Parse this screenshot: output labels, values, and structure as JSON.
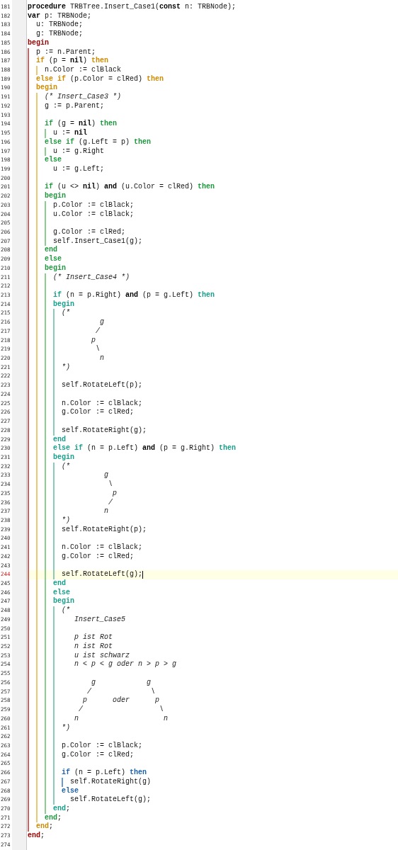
{
  "lines": [
    {
      "number": "181",
      "current": false,
      "tokens": [
        {
          "text": "procedure",
          "kind": "keyword",
          "color": "#000000"
        },
        {
          "text": " TRBTree.Insert_Case1(",
          "kind": "plain"
        },
        {
          "text": "const",
          "kind": "keyword",
          "color": "#000000"
        },
        {
          "text": " n: TRBNode);",
          "kind": "plain"
        }
      ]
    },
    {
      "number": "182",
      "current": false,
      "tokens": [
        {
          "text": "var",
          "kind": "keyword",
          "color": "#000000"
        },
        {
          "text": " p: TRBNode;",
          "kind": "plain"
        }
      ]
    },
    {
      "number": "183",
      "current": false,
      "tokens": [
        {
          "text": "  u: TRBNode;",
          "kind": "plain"
        }
      ]
    },
    {
      "number": "184",
      "current": false,
      "tokens": [
        {
          "text": "  g: TRBNode;",
          "kind": "plain"
        }
      ]
    },
    {
      "number": "185",
      "current": false,
      "tokens": [
        {
          "text": "begin",
          "kind": "keyword",
          "color": "#a00000"
        }
      ]
    },
    {
      "number": "186",
      "current": false,
      "guides": [
        {
          "color": "#d06060"
        }
      ],
      "tokens": [
        {
          "text": "  p := n.Parent;",
          "kind": "plain"
        }
      ]
    },
    {
      "number": "187",
      "current": false,
      "guides": [
        {
          "color": "#d06060"
        }
      ],
      "tokens": [
        {
          "text": "  if",
          "kind": "keyword",
          "color": "#d08a00"
        },
        {
          "text": " (p = ",
          "kind": "plain"
        },
        {
          "text": "nil",
          "kind": "keyword",
          "color": "#000000"
        },
        {
          "text": ") ",
          "kind": "plain"
        },
        {
          "text": "then",
          "kind": "keyword",
          "color": "#d08a00"
        }
      ]
    },
    {
      "number": "188",
      "current": false,
      "guides": [
        {
          "color": "#d06060"
        },
        {
          "color": "#e8c870"
        }
      ],
      "tokens": [
        {
          "text": "    n.Color := clBlack",
          "kind": "plain"
        }
      ]
    },
    {
      "number": "189",
      "current": false,
      "guides": [
        {
          "color": "#d06060"
        }
      ],
      "tokens": [
        {
          "text": "  else if",
          "kind": "keyword",
          "color": "#d08a00"
        },
        {
          "text": " (p.Color = clRed) ",
          "kind": "plain"
        },
        {
          "text": "then",
          "kind": "keyword",
          "color": "#d08a00"
        }
      ]
    },
    {
      "number": "190",
      "current": false,
      "guides": [
        {
          "color": "#d06060"
        }
      ],
      "tokens": [
        {
          "text": "  begin",
          "kind": "keyword",
          "color": "#d08a00"
        }
      ]
    },
    {
      "number": "191",
      "current": false,
      "guides": [
        {
          "color": "#d06060"
        },
        {
          "color": "#e8c870"
        }
      ],
      "tokens": [
        {
          "text": "    (* Insert_Case3 *)",
          "kind": "comment"
        }
      ]
    },
    {
      "number": "192",
      "current": false,
      "guides": [
        {
          "color": "#d06060"
        },
        {
          "color": "#e8c870"
        }
      ],
      "tokens": [
        {
          "text": "    g := p.Parent;",
          "kind": "plain"
        }
      ]
    },
    {
      "number": "193",
      "current": false,
      "guides": [
        {
          "color": "#d06060"
        },
        {
          "color": "#e8c870"
        }
      ]
    },
    {
      "number": "194",
      "current": false,
      "guides": [
        {
          "color": "#d06060"
        },
        {
          "color": "#e8c870"
        }
      ],
      "tokens": [
        {
          "text": "    if",
          "kind": "keyword",
          "color": "#1a9a3a"
        },
        {
          "text": " (g = ",
          "kind": "plain"
        },
        {
          "text": "nil",
          "kind": "keyword",
          "color": "#000000"
        },
        {
          "text": ") ",
          "kind": "plain"
        },
        {
          "text": "then",
          "kind": "keyword",
          "color": "#1a9a3a"
        }
      ]
    },
    {
      "number": "195",
      "current": false,
      "guides": [
        {
          "color": "#d06060"
        },
        {
          "color": "#e8c870"
        },
        {
          "color": "#8ccc8c"
        }
      ],
      "tokens": [
        {
          "text": "      u := ",
          "kind": "plain"
        },
        {
          "text": "nil",
          "kind": "keyword",
          "color": "#000000"
        }
      ]
    },
    {
      "number": "196",
      "current": false,
      "guides": [
        {
          "color": "#d06060"
        },
        {
          "color": "#e8c870"
        }
      ],
      "tokens": [
        {
          "text": "    else if",
          "kind": "keyword",
          "color": "#1a9a3a"
        },
        {
          "text": " (g.Left = p) ",
          "kind": "plain"
        },
        {
          "text": "then",
          "kind": "keyword",
          "color": "#1a9a3a"
        }
      ]
    },
    {
      "number": "197",
      "current": false,
      "guides": [
        {
          "color": "#d06060"
        },
        {
          "color": "#e8c870"
        },
        {
          "color": "#8ccc8c"
        }
      ],
      "tokens": [
        {
          "text": "      u := g.Right",
          "kind": "plain"
        }
      ]
    },
    {
      "number": "198",
      "current": false,
      "guides": [
        {
          "color": "#d06060"
        },
        {
          "color": "#e8c870"
        }
      ],
      "tokens": [
        {
          "text": "    else",
          "kind": "keyword",
          "color": "#1a9a3a"
        }
      ]
    },
    {
      "number": "199",
      "current": false,
      "guides": [
        {
          "color": "#d06060"
        },
        {
          "color": "#e8c870"
        }
      ],
      "tokens": [
        {
          "text": "      u := g.Left;",
          "kind": "plain"
        }
      ]
    },
    {
      "number": "200",
      "current": false,
      "guides": [
        {
          "color": "#d06060"
        },
        {
          "color": "#e8c870"
        }
      ]
    },
    {
      "number": "201",
      "current": false,
      "guides": [
        {
          "color": "#d06060"
        },
        {
          "color": "#e8c870"
        }
      ],
      "tokens": [
        {
          "text": "    if",
          "kind": "keyword",
          "color": "#1a9a3a"
        },
        {
          "text": " (u <> ",
          "kind": "plain"
        },
        {
          "text": "nil",
          "kind": "keyword",
          "color": "#000000"
        },
        {
          "text": ") ",
          "kind": "plain"
        },
        {
          "text": "and",
          "kind": "keyword",
          "color": "#000000"
        },
        {
          "text": " (u.Color = clRed) ",
          "kind": "plain"
        },
        {
          "text": "then",
          "kind": "keyword",
          "color": "#1a9a3a"
        }
      ]
    },
    {
      "number": "202",
      "current": false,
      "guides": [
        {
          "color": "#d06060"
        },
        {
          "color": "#e8c870"
        }
      ],
      "tokens": [
        {
          "text": "    begin",
          "kind": "keyword",
          "color": "#1a9a3a"
        }
      ]
    },
    {
      "number": "203",
      "current": false,
      "guides": [
        {
          "color": "#d06060"
        },
        {
          "color": "#e8c870"
        },
        {
          "color": "#8ccc8c"
        }
      ],
      "tokens": [
        {
          "text": "      p.Color := clBlack;",
          "kind": "plain"
        }
      ]
    },
    {
      "number": "204",
      "current": false,
      "guides": [
        {
          "color": "#d06060"
        },
        {
          "color": "#e8c870"
        },
        {
          "color": "#8ccc8c"
        }
      ],
      "tokens": [
        {
          "text": "      u.Color := clBlack;",
          "kind": "plain"
        }
      ]
    },
    {
      "number": "205",
      "current": false,
      "guides": [
        {
          "color": "#d06060"
        },
        {
          "color": "#e8c870"
        },
        {
          "color": "#8ccc8c"
        }
      ]
    },
    {
      "number": "206",
      "current": false,
      "guides": [
        {
          "color": "#d06060"
        },
        {
          "color": "#e8c870"
        },
        {
          "color": "#8ccc8c"
        }
      ],
      "tokens": [
        {
          "text": "      g.Color := clRed;",
          "kind": "plain"
        }
      ]
    },
    {
      "number": "207",
      "current": false,
      "guides": [
        {
          "color": "#d06060"
        },
        {
          "color": "#e8c870"
        },
        {
          "color": "#8ccc8c"
        }
      ],
      "tokens": [
        {
          "text": "      self.Insert_Case1(g);",
          "kind": "plain"
        }
      ]
    },
    {
      "number": "208",
      "current": false,
      "guides": [
        {
          "color": "#d06060"
        },
        {
          "color": "#e8c870"
        }
      ],
      "tokens": [
        {
          "text": "    end",
          "kind": "keyword",
          "color": "#1a9a3a"
        }
      ]
    },
    {
      "number": "209",
      "current": false,
      "guides": [
        {
          "color": "#d06060"
        },
        {
          "color": "#e8c870"
        }
      ],
      "tokens": [
        {
          "text": "    else",
          "kind": "keyword",
          "color": "#1a9a3a"
        }
      ]
    },
    {
      "number": "210",
      "current": false,
      "guides": [
        {
          "color": "#d06060"
        },
        {
          "color": "#e8c870"
        }
      ],
      "tokens": [
        {
          "text": "    begin",
          "kind": "keyword",
          "color": "#1a9a3a"
        }
      ]
    },
    {
      "number": "211",
      "current": false,
      "guides": [
        {
          "color": "#d06060"
        },
        {
          "color": "#e8c870"
        },
        {
          "color": "#8ccc8c"
        }
      ],
      "tokens": [
        {
          "text": "      (* Insert_Case4 *)",
          "kind": "comment"
        }
      ]
    },
    {
      "number": "212",
      "current": false,
      "guides": [
        {
          "color": "#d06060"
        },
        {
          "color": "#e8c870"
        },
        {
          "color": "#8ccc8c"
        }
      ]
    },
    {
      "number": "213",
      "current": false,
      "guides": [
        {
          "color": "#d06060"
        },
        {
          "color": "#e8c870"
        },
        {
          "color": "#8ccc8c"
        }
      ],
      "tokens": [
        {
          "text": "      if",
          "kind": "keyword",
          "color": "#14a08a"
        },
        {
          "text": " (n = p.Right) ",
          "kind": "plain"
        },
        {
          "text": "and",
          "kind": "keyword",
          "color": "#000000"
        },
        {
          "text": " (p = g.Left) ",
          "kind": "plain"
        },
        {
          "text": "then",
          "kind": "keyword",
          "color": "#14a08a"
        }
      ]
    },
    {
      "number": "214",
      "current": false,
      "guides": [
        {
          "color": "#d06060"
        },
        {
          "color": "#e8c870"
        },
        {
          "color": "#8ccc8c"
        }
      ],
      "tokens": [
        {
          "text": "      begin",
          "kind": "keyword",
          "color": "#14a08a"
        }
      ]
    },
    {
      "number": "215",
      "current": false,
      "guides": [
        {
          "color": "#d06060"
        },
        {
          "color": "#e8c870"
        },
        {
          "color": "#8ccc8c"
        },
        {
          "color": "#88ccb8"
        }
      ],
      "tokens": [
        {
          "text": "        (*",
          "kind": "comment"
        }
      ]
    },
    {
      "number": "216",
      "current": false,
      "guides": [
        {
          "color": "#d06060"
        },
        {
          "color": "#e8c870"
        },
        {
          "color": "#8ccc8c"
        },
        {
          "color": "#88ccb8"
        }
      ],
      "tokens": [
        {
          "text": "                 g",
          "kind": "comment"
        }
      ]
    },
    {
      "number": "217",
      "current": false,
      "guides": [
        {
          "color": "#d06060"
        },
        {
          "color": "#e8c870"
        },
        {
          "color": "#8ccc8c"
        },
        {
          "color": "#88ccb8"
        }
      ],
      "tokens": [
        {
          "text": "                /",
          "kind": "comment"
        }
      ]
    },
    {
      "number": "218",
      "current": false,
      "guides": [
        {
          "color": "#d06060"
        },
        {
          "color": "#e8c870"
        },
        {
          "color": "#8ccc8c"
        },
        {
          "color": "#88ccb8"
        }
      ],
      "tokens": [
        {
          "text": "               p",
          "kind": "comment"
        }
      ]
    },
    {
      "number": "219",
      "current": false,
      "guides": [
        {
          "color": "#d06060"
        },
        {
          "color": "#e8c870"
        },
        {
          "color": "#8ccc8c"
        },
        {
          "color": "#88ccb8"
        }
      ],
      "tokens": [
        {
          "text": "                \\",
          "kind": "comment"
        }
      ]
    },
    {
      "number": "220",
      "current": false,
      "guides": [
        {
          "color": "#d06060"
        },
        {
          "color": "#e8c870"
        },
        {
          "color": "#8ccc8c"
        },
        {
          "color": "#88ccb8"
        }
      ],
      "tokens": [
        {
          "text": "                 n",
          "kind": "comment"
        }
      ]
    },
    {
      "number": "221",
      "current": false,
      "guides": [
        {
          "color": "#d06060"
        },
        {
          "color": "#e8c870"
        },
        {
          "color": "#8ccc8c"
        },
        {
          "color": "#88ccb8"
        }
      ],
      "tokens": [
        {
          "text": "        *)",
          "kind": "comment"
        }
      ]
    },
    {
      "number": "222",
      "current": false,
      "guides": [
        {
          "color": "#d06060"
        },
        {
          "color": "#e8c870"
        },
        {
          "color": "#8ccc8c"
        },
        {
          "color": "#88ccb8"
        }
      ]
    },
    {
      "number": "223",
      "current": false,
      "guides": [
        {
          "color": "#d06060"
        },
        {
          "color": "#e8c870"
        },
        {
          "color": "#8ccc8c"
        },
        {
          "color": "#88ccb8"
        }
      ],
      "tokens": [
        {
          "text": "        self.RotateLeft(p);",
          "kind": "plain"
        }
      ]
    },
    {
      "number": "224",
      "current": false,
      "guides": [
        {
          "color": "#d06060"
        },
        {
          "color": "#e8c870"
        },
        {
          "color": "#8ccc8c"
        },
        {
          "color": "#88ccb8"
        }
      ]
    },
    {
      "number": "225",
      "current": false,
      "guides": [
        {
          "color": "#d06060"
        },
        {
          "color": "#e8c870"
        },
        {
          "color": "#8ccc8c"
        },
        {
          "color": "#88ccb8"
        }
      ],
      "tokens": [
        {
          "text": "        n.Color := clBlack;",
          "kind": "plain"
        }
      ]
    },
    {
      "number": "226",
      "current": false,
      "guides": [
        {
          "color": "#d06060"
        },
        {
          "color": "#e8c870"
        },
        {
          "color": "#8ccc8c"
        },
        {
          "color": "#88ccb8"
        }
      ],
      "tokens": [
        {
          "text": "        g.Color := clRed;",
          "kind": "plain"
        }
      ]
    },
    {
      "number": "227",
      "current": false,
      "guides": [
        {
          "color": "#d06060"
        },
        {
          "color": "#e8c870"
        },
        {
          "color": "#8ccc8c"
        },
        {
          "color": "#88ccb8"
        }
      ]
    },
    {
      "number": "228",
      "current": false,
      "guides": [
        {
          "color": "#d06060"
        },
        {
          "color": "#e8c870"
        },
        {
          "color": "#8ccc8c"
        },
        {
          "color": "#88ccb8"
        }
      ],
      "tokens": [
        {
          "text": "        self.RotateRight(g);",
          "kind": "plain"
        }
      ]
    },
    {
      "number": "229",
      "current": false,
      "guides": [
        {
          "color": "#d06060"
        },
        {
          "color": "#e8c870"
        },
        {
          "color": "#8ccc8c"
        }
      ],
      "tokens": [
        {
          "text": "      end",
          "kind": "keyword",
          "color": "#14a08a"
        }
      ]
    },
    {
      "number": "230",
      "current": false,
      "guides": [
        {
          "color": "#d06060"
        },
        {
          "color": "#e8c870"
        },
        {
          "color": "#8ccc8c"
        }
      ],
      "tokens": [
        {
          "text": "      else if",
          "kind": "keyword",
          "color": "#14a08a"
        },
        {
          "text": " (n = p.Left) ",
          "kind": "plain"
        },
        {
          "text": "and",
          "kind": "keyword",
          "color": "#000000"
        },
        {
          "text": " (p = g.Right) ",
          "kind": "plain"
        },
        {
          "text": "then",
          "kind": "keyword",
          "color": "#14a08a"
        }
      ]
    },
    {
      "number": "231",
      "current": false,
      "guides": [
        {
          "color": "#d06060"
        },
        {
          "color": "#e8c870"
        },
        {
          "color": "#8ccc8c"
        }
      ],
      "tokens": [
        {
          "text": "      begin",
          "kind": "keyword",
          "color": "#14a08a"
        }
      ]
    },
    {
      "number": "232",
      "current": false,
      "guides": [
        {
          "color": "#d06060"
        },
        {
          "color": "#e8c870"
        },
        {
          "color": "#8ccc8c"
        },
        {
          "color": "#88ccb8"
        }
      ],
      "tokens": [
        {
          "text": "        (*",
          "kind": "comment"
        }
      ]
    },
    {
      "number": "233",
      "current": false,
      "guides": [
        {
          "color": "#d06060"
        },
        {
          "color": "#e8c870"
        },
        {
          "color": "#8ccc8c"
        },
        {
          "color": "#88ccb8"
        }
      ],
      "tokens": [
        {
          "text": "                  g",
          "kind": "comment"
        }
      ]
    },
    {
      "number": "234",
      "current": false,
      "guides": [
        {
          "color": "#d06060"
        },
        {
          "color": "#e8c870"
        },
        {
          "color": "#8ccc8c"
        },
        {
          "color": "#88ccb8"
        }
      ],
      "tokens": [
        {
          "text": "                   \\",
          "kind": "comment"
        }
      ]
    },
    {
      "number": "235",
      "current": false,
      "guides": [
        {
          "color": "#d06060"
        },
        {
          "color": "#e8c870"
        },
        {
          "color": "#8ccc8c"
        },
        {
          "color": "#88ccb8"
        }
      ],
      "tokens": [
        {
          "text": "                    p",
          "kind": "comment"
        }
      ]
    },
    {
      "number": "236",
      "current": false,
      "guides": [
        {
          "color": "#d06060"
        },
        {
          "color": "#e8c870"
        },
        {
          "color": "#8ccc8c"
        },
        {
          "color": "#88ccb8"
        }
      ],
      "tokens": [
        {
          "text": "                   /",
          "kind": "comment"
        }
      ]
    },
    {
      "number": "237",
      "current": false,
      "guides": [
        {
          "color": "#d06060"
        },
        {
          "color": "#e8c870"
        },
        {
          "color": "#8ccc8c"
        },
        {
          "color": "#88ccb8"
        }
      ],
      "tokens": [
        {
          "text": "                  n",
          "kind": "comment"
        }
      ]
    },
    {
      "number": "238",
      "current": false,
      "guides": [
        {
          "color": "#d06060"
        },
        {
          "color": "#e8c870"
        },
        {
          "color": "#8ccc8c"
        },
        {
          "color": "#88ccb8"
        }
      ],
      "tokens": [
        {
          "text": "        *)",
          "kind": "comment"
        }
      ]
    },
    {
      "number": "239",
      "current": false,
      "guides": [
        {
          "color": "#d06060"
        },
        {
          "color": "#e8c870"
        },
        {
          "color": "#8ccc8c"
        },
        {
          "color": "#88ccb8"
        }
      ],
      "tokens": [
        {
          "text": "        self.RotateRight(p);",
          "kind": "plain"
        }
      ]
    },
    {
      "number": "240",
      "current": false,
      "guides": [
        {
          "color": "#d06060"
        },
        {
          "color": "#e8c870"
        },
        {
          "color": "#8ccc8c"
        },
        {
          "color": "#88ccb8"
        }
      ]
    },
    {
      "number": "241",
      "current": false,
      "guides": [
        {
          "color": "#d06060"
        },
        {
          "color": "#e8c870"
        },
        {
          "color": "#8ccc8c"
        },
        {
          "color": "#88ccb8"
        }
      ],
      "tokens": [
        {
          "text": "        n.Color := clBlack;",
          "kind": "plain"
        }
      ]
    },
    {
      "number": "242",
      "current": false,
      "guides": [
        {
          "color": "#d06060"
        },
        {
          "color": "#e8c870"
        },
        {
          "color": "#8ccc8c"
        },
        {
          "color": "#88ccb8"
        }
      ],
      "tokens": [
        {
          "text": "        g.Color := clRed;",
          "kind": "plain"
        }
      ]
    },
    {
      "number": "243",
      "current": false,
      "guides": [
        {
          "color": "#d06060"
        },
        {
          "color": "#e8c870"
        },
        {
          "color": "#8ccc8c"
        },
        {
          "color": "#88ccb8"
        }
      ]
    },
    {
      "number": "244",
      "current": true,
      "guides": [
        {
          "color": "#d06060"
        },
        {
          "color": "#e8c870"
        },
        {
          "color": "#8ccc8c"
        },
        {
          "color": "#88ccb8"
        }
      ],
      "tokens": [
        {
          "text": "        self.RotateLeft(g);",
          "kind": "plain"
        }
      ]
    },
    {
      "number": "245",
      "current": false,
      "guides": [
        {
          "color": "#d06060"
        },
        {
          "color": "#e8c870"
        },
        {
          "color": "#8ccc8c"
        }
      ],
      "tokens": [
        {
          "text": "      end",
          "kind": "keyword",
          "color": "#14a08a"
        }
      ]
    },
    {
      "number": "246",
      "current": false,
      "guides": [
        {
          "color": "#d06060"
        },
        {
          "color": "#e8c870"
        },
        {
          "color": "#8ccc8c"
        }
      ],
      "tokens": [
        {
          "text": "      else",
          "kind": "keyword",
          "color": "#14a08a"
        }
      ]
    },
    {
      "number": "247",
      "current": false,
      "guides": [
        {
          "color": "#d06060"
        },
        {
          "color": "#e8c870"
        },
        {
          "color": "#8ccc8c"
        }
      ],
      "tokens": [
        {
          "text": "      begin",
          "kind": "keyword",
          "color": "#14a08a"
        }
      ]
    },
    {
      "number": "248",
      "current": false,
      "guides": [
        {
          "color": "#d06060"
        },
        {
          "color": "#e8c870"
        },
        {
          "color": "#8ccc8c"
        },
        {
          "color": "#88ccb8"
        }
      ],
      "tokens": [
        {
          "text": "        (*",
          "kind": "comment"
        }
      ]
    },
    {
      "number": "249",
      "current": false,
      "guides": [
        {
          "color": "#d06060"
        },
        {
          "color": "#e8c870"
        },
        {
          "color": "#8ccc8c"
        },
        {
          "color": "#88ccb8"
        }
      ],
      "tokens": [
        {
          "text": "           Insert_Case5",
          "kind": "comment"
        }
      ]
    },
    {
      "number": "250",
      "current": false,
      "guides": [
        {
          "color": "#d06060"
        },
        {
          "color": "#e8c870"
        },
        {
          "color": "#8ccc8c"
        },
        {
          "color": "#88ccb8"
        }
      ]
    },
    {
      "number": "251",
      "current": false,
      "guides": [
        {
          "color": "#d06060"
        },
        {
          "color": "#e8c870"
        },
        {
          "color": "#8ccc8c"
        },
        {
          "color": "#88ccb8"
        }
      ],
      "tokens": [
        {
          "text": "           p ist Rot",
          "kind": "comment"
        }
      ]
    },
    {
      "number": "252",
      "current": false,
      "guides": [
        {
          "color": "#d06060"
        },
        {
          "color": "#e8c870"
        },
        {
          "color": "#8ccc8c"
        },
        {
          "color": "#88ccb8"
        }
      ],
      "tokens": [
        {
          "text": "           n ist Rot",
          "kind": "comment"
        }
      ]
    },
    {
      "number": "253",
      "current": false,
      "guides": [
        {
          "color": "#d06060"
        },
        {
          "color": "#e8c870"
        },
        {
          "color": "#8ccc8c"
        },
        {
          "color": "#88ccb8"
        }
      ],
      "tokens": [
        {
          "text": "           u ist schwarz",
          "kind": "comment"
        }
      ]
    },
    {
      "number": "254",
      "current": false,
      "guides": [
        {
          "color": "#d06060"
        },
        {
          "color": "#e8c870"
        },
        {
          "color": "#8ccc8c"
        },
        {
          "color": "#88ccb8"
        }
      ],
      "tokens": [
        {
          "text": "           n < p < g oder n > p > g",
          "kind": "comment"
        }
      ]
    },
    {
      "number": "255",
      "current": false,
      "guides": [
        {
          "color": "#d06060"
        },
        {
          "color": "#e8c870"
        },
        {
          "color": "#8ccc8c"
        },
        {
          "color": "#88ccb8"
        }
      ]
    },
    {
      "number": "256",
      "current": false,
      "guides": [
        {
          "color": "#d06060"
        },
        {
          "color": "#e8c870"
        },
        {
          "color": "#8ccc8c"
        },
        {
          "color": "#88ccb8"
        }
      ],
      "tokens": [
        {
          "text": "               g            g",
          "kind": "comment"
        }
      ]
    },
    {
      "number": "257",
      "current": false,
      "guides": [
        {
          "color": "#d06060"
        },
        {
          "color": "#e8c870"
        },
        {
          "color": "#8ccc8c"
        },
        {
          "color": "#88ccb8"
        }
      ],
      "tokens": [
        {
          "text": "              /              \\",
          "kind": "comment"
        }
      ]
    },
    {
      "number": "258",
      "current": false,
      "guides": [
        {
          "color": "#d06060"
        },
        {
          "color": "#e8c870"
        },
        {
          "color": "#8ccc8c"
        },
        {
          "color": "#88ccb8"
        }
      ],
      "tokens": [
        {
          "text": "             p      oder      p",
          "kind": "comment"
        }
      ]
    },
    {
      "number": "259",
      "current": false,
      "guides": [
        {
          "color": "#d06060"
        },
        {
          "color": "#e8c870"
        },
        {
          "color": "#8ccc8c"
        },
        {
          "color": "#88ccb8"
        }
      ],
      "tokens": [
        {
          "text": "            /                  \\",
          "kind": "comment"
        }
      ]
    },
    {
      "number": "260",
      "current": false,
      "guides": [
        {
          "color": "#d06060"
        },
        {
          "color": "#e8c870"
        },
        {
          "color": "#8ccc8c"
        },
        {
          "color": "#88ccb8"
        }
      ],
      "tokens": [
        {
          "text": "           n                    n",
          "kind": "comment"
        }
      ]
    },
    {
      "number": "261",
      "current": false,
      "guides": [
        {
          "color": "#d06060"
        },
        {
          "color": "#e8c870"
        },
        {
          "color": "#8ccc8c"
        },
        {
          "color": "#88ccb8"
        }
      ],
      "tokens": [
        {
          "text": "        *)",
          "kind": "comment"
        }
      ]
    },
    {
      "number": "262",
      "current": false,
      "guides": [
        {
          "color": "#d06060"
        },
        {
          "color": "#e8c870"
        },
        {
          "color": "#8ccc8c"
        },
        {
          "color": "#88ccb8"
        }
      ]
    },
    {
      "number": "263",
      "current": false,
      "guides": [
        {
          "color": "#d06060"
        },
        {
          "color": "#e8c870"
        },
        {
          "color": "#8ccc8c"
        },
        {
          "color": "#88ccb8"
        }
      ],
      "tokens": [
        {
          "text": "        p.Color := clBlack;",
          "kind": "plain"
        }
      ]
    },
    {
      "number": "264",
      "current": false,
      "guides": [
        {
          "color": "#d06060"
        },
        {
          "color": "#e8c870"
        },
        {
          "color": "#8ccc8c"
        },
        {
          "color": "#88ccb8"
        }
      ],
      "tokens": [
        {
          "text": "        g.Color := clRed;",
          "kind": "plain"
        }
      ]
    },
    {
      "number": "265",
      "current": false,
      "guides": [
        {
          "color": "#d06060"
        },
        {
          "color": "#e8c870"
        },
        {
          "color": "#8ccc8c"
        },
        {
          "color": "#88ccb8"
        }
      ]
    },
    {
      "number": "266",
      "current": false,
      "guides": [
        {
          "color": "#d06060"
        },
        {
          "color": "#e8c870"
        },
        {
          "color": "#8ccc8c"
        },
        {
          "color": "#88ccb8"
        }
      ],
      "tokens": [
        {
          "text": "        if",
          "kind": "keyword",
          "color": "#1a60b0"
        },
        {
          "text": " (n = p.Left) ",
          "kind": "plain"
        },
        {
          "text": "then",
          "kind": "keyword",
          "color": "#1a60b0"
        }
      ]
    },
    {
      "number": "267",
      "current": false,
      "guides": [
        {
          "color": "#d06060"
        },
        {
          "color": "#e8c870"
        },
        {
          "color": "#8ccc8c"
        },
        {
          "color": "#88ccb8"
        },
        {
          "color": "#6c98d0"
        }
      ],
      "tokens": [
        {
          "text": "          self.RotateRight(g)",
          "kind": "plain"
        }
      ]
    },
    {
      "number": "268",
      "current": false,
      "guides": [
        {
          "color": "#d06060"
        },
        {
          "color": "#e8c870"
        },
        {
          "color": "#8ccc8c"
        },
        {
          "color": "#88ccb8"
        }
      ],
      "tokens": [
        {
          "text": "        else",
          "kind": "keyword",
          "color": "#1a60b0"
        }
      ]
    },
    {
      "number": "269",
      "current": false,
      "guides": [
        {
          "color": "#d06060"
        },
        {
          "color": "#e8c870"
        },
        {
          "color": "#8ccc8c"
        },
        {
          "color": "#88ccb8"
        }
      ],
      "tokens": [
        {
          "text": "          self.RotateLeft(g);",
          "kind": "plain"
        }
      ]
    },
    {
      "number": "270",
      "current": false,
      "guides": [
        {
          "color": "#d06060"
        },
        {
          "color": "#e8c870"
        },
        {
          "color": "#8ccc8c"
        }
      ],
      "tokens": [
        {
          "text": "      end",
          "kind": "keyword",
          "color": "#14a08a"
        },
        {
          "text": ";",
          "kind": "plain"
        }
      ]
    },
    {
      "number": "271",
      "current": false,
      "guides": [
        {
          "color": "#d06060"
        },
        {
          "color": "#e8c870"
        }
      ],
      "tokens": [
        {
          "text": "    end",
          "kind": "keyword",
          "color": "#1a9a3a"
        },
        {
          "text": ";",
          "kind": "plain"
        }
      ]
    },
    {
      "number": "272",
      "current": false,
      "guides": [
        {
          "color": "#d06060"
        }
      ],
      "tokens": [
        {
          "text": "  end",
          "kind": "keyword",
          "color": "#d08a00"
        },
        {
          "text": ";",
          "kind": "plain"
        }
      ]
    },
    {
      "number": "273",
      "current": false,
      "tokens": [
        {
          "text": "end",
          "kind": "keyword",
          "color": "#a00000"
        },
        {
          "text": ";",
          "kind": "plain"
        }
      ]
    },
    {
      "number": "274",
      "current": false
    }
  ]
}
